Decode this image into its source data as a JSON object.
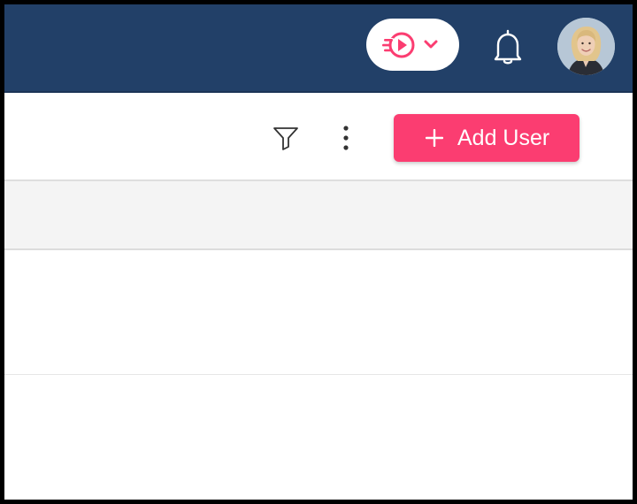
{
  "header": {
    "background": "#224068",
    "play_menu": {
      "icon": "play-icon",
      "chevron": "chevron-down-icon",
      "accent": "#fb3d71"
    },
    "notifications": {
      "icon": "bell-icon"
    },
    "user_avatar": {
      "icon": "avatar"
    }
  },
  "toolbar": {
    "filter_icon": "filter-icon",
    "more_icon": "more-vertical-icon",
    "add_user_button": {
      "icon": "plus-icon",
      "label": "Add User",
      "color": "#fb3d71"
    }
  },
  "table": {
    "header_background": "#f4f4f4",
    "rows": []
  }
}
